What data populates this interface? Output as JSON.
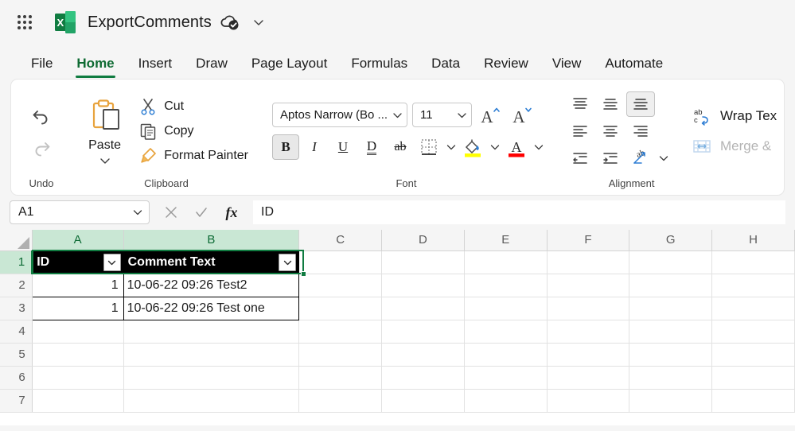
{
  "titlebar": {
    "app_launcher": "app-launcher",
    "app_icon": "excel-icon",
    "document_title": "ExportComments",
    "save_status_icon": "cloud-saved-icon",
    "title_menu_icon": "chevron-down-icon"
  },
  "tabs": [
    {
      "label": "File",
      "active": false
    },
    {
      "label": "Home",
      "active": true
    },
    {
      "label": "Insert",
      "active": false
    },
    {
      "label": "Draw",
      "active": false
    },
    {
      "label": "Page Layout",
      "active": false
    },
    {
      "label": "Formulas",
      "active": false
    },
    {
      "label": "Data",
      "active": false
    },
    {
      "label": "Review",
      "active": false
    },
    {
      "label": "View",
      "active": false
    },
    {
      "label": "Automate",
      "active": false
    }
  ],
  "ribbon": {
    "groups": {
      "undo": {
        "label": "Undo",
        "undo_tooltip": "Undo",
        "redo_tooltip": "Redo"
      },
      "clipboard": {
        "label": "Clipboard",
        "paste_label": "Paste",
        "cut_label": "Cut",
        "copy_label": "Copy",
        "format_painter_label": "Format Painter"
      },
      "font": {
        "label": "Font",
        "font_name": "Aptos Narrow (Bo ...",
        "font_size": "11",
        "grow_font": "A",
        "shrink_font": "A",
        "bold": "B",
        "italic": "I",
        "underline": "U",
        "double_underline": "D",
        "strikethrough": "ab",
        "fill_color_hex": "#FFFF00",
        "font_color_hex": "#FF0000"
      },
      "alignment": {
        "label": "Alignment",
        "wrap_text_label": "Wrap Tex",
        "merge_center_label": "Merge &"
      }
    }
  },
  "formula_bar": {
    "name_box": "A1",
    "cancel_icon": "cancel-icon",
    "enter_icon": "enter-icon",
    "function_icon": "fx",
    "formula_value": "ID"
  },
  "grid": {
    "columns": [
      "A",
      "B",
      "C",
      "D",
      "E",
      "F",
      "G",
      "H"
    ],
    "selected_columns": [
      "A",
      "B"
    ],
    "rows": [
      "1",
      "2",
      "3",
      "4",
      "5",
      "6",
      "7"
    ],
    "selected_rows": [
      "1"
    ],
    "table_headers": [
      "ID",
      "Comment Text"
    ],
    "filter_icon": "filter-dropdown-icon",
    "data": [
      {
        "row": "2",
        "A": "1",
        "B": "10-06-22 09:26 Test2"
      },
      {
        "row": "3",
        "A": "1",
        "B": "10-06-22 09:26 Test one"
      }
    ]
  },
  "colors": {
    "excel_green": "#107c41",
    "selection_green": "#107c41",
    "header_selected_bg": "#c9e7d4"
  }
}
